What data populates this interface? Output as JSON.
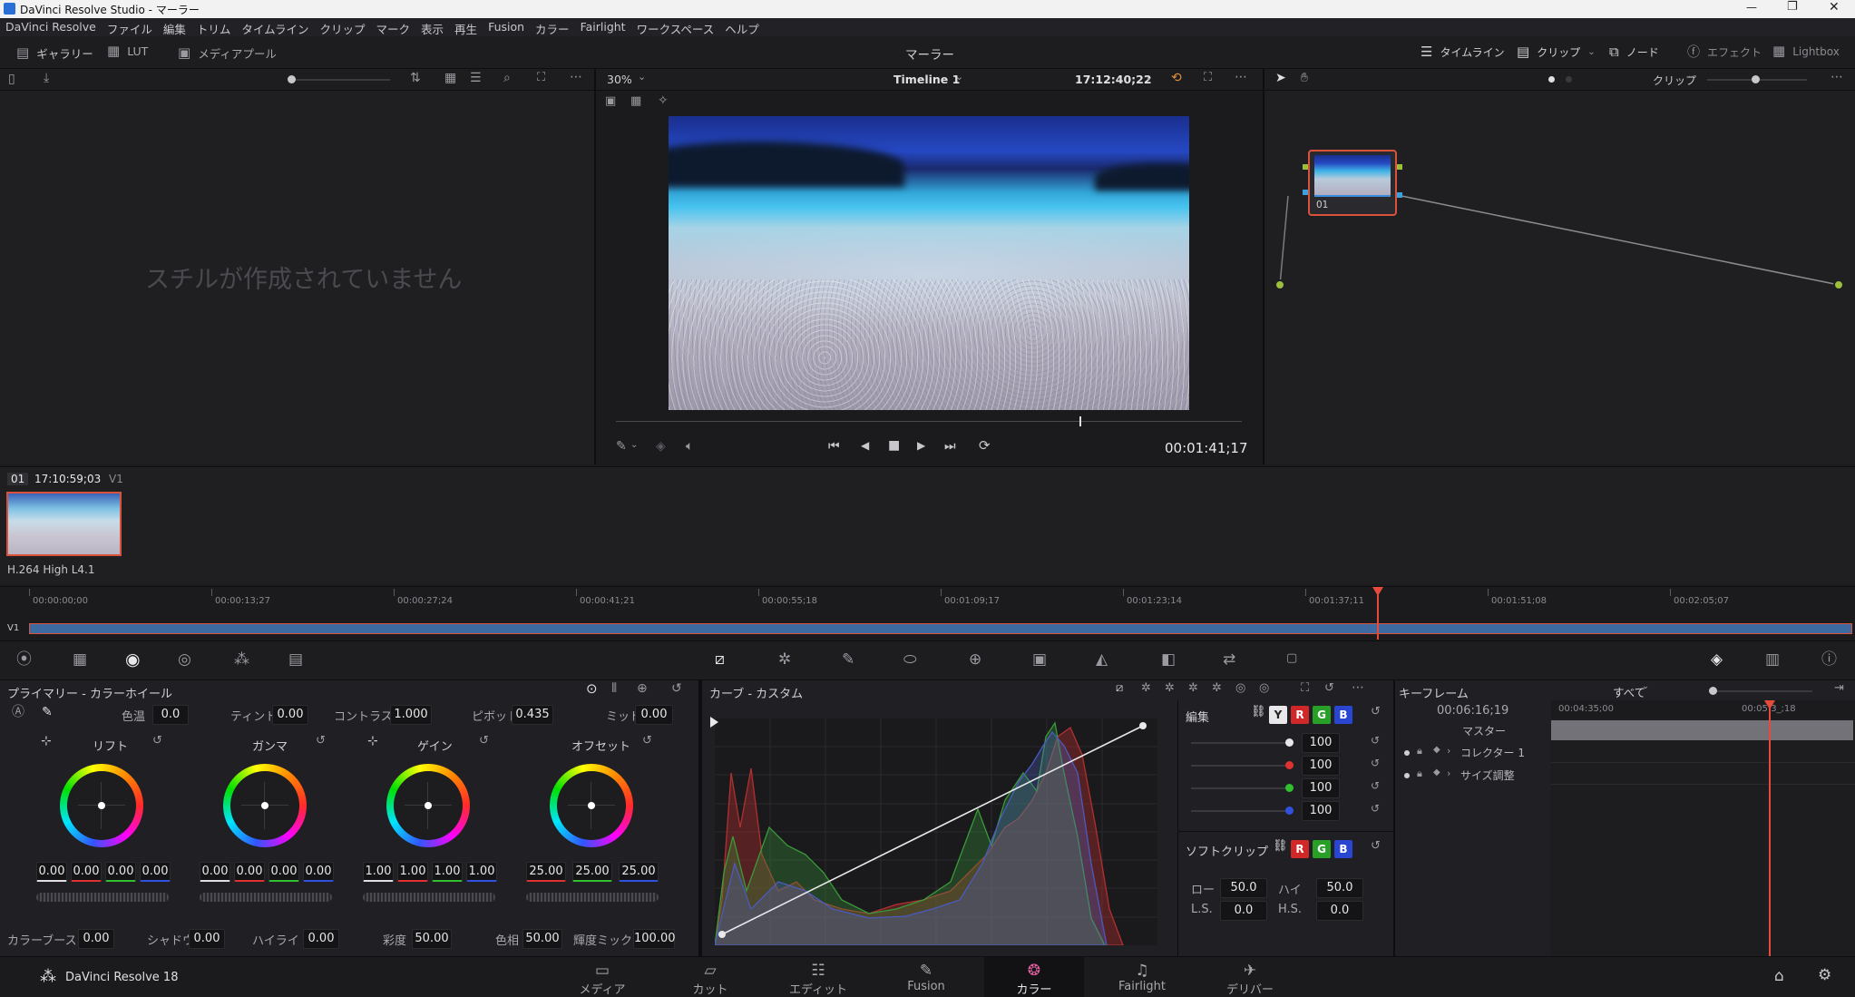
{
  "window": {
    "title": "DaVinci Resolve Studio - マーラー",
    "controls": [
      "—",
      "❐",
      "✕"
    ]
  },
  "menu": [
    "DaVinci Resolve",
    "ファイル",
    "編集",
    "トリム",
    "タイムライン",
    "クリップ",
    "マーク",
    "表示",
    "再生",
    "Fusion",
    "カラー",
    "Fairlight",
    "ワークスペース",
    "ヘルプ"
  ],
  "toolbar": {
    "left": [
      {
        "icon": "gallery-icon",
        "label": "ギャラリー"
      },
      {
        "icon": "lut-icon",
        "label": "LUT"
      },
      {
        "icon": "media-pool-icon",
        "label": "メディアプール"
      }
    ],
    "project_title": "マーラー",
    "right": [
      {
        "icon": "timeline-icon",
        "label": "タイムライン"
      },
      {
        "icon": "clips-icon",
        "label": "クリップ"
      },
      {
        "icon": "nodes-icon",
        "label": "ノード"
      },
      {
        "icon": "effects-icon",
        "label": "エフェクト"
      },
      {
        "icon": "lightbox-icon",
        "label": "Lightbox"
      }
    ]
  },
  "gallery": {
    "empty_message": "スチルが作成されていません"
  },
  "viewer": {
    "zoom": "30%",
    "timeline_name": "Timeline 1",
    "source_timecode": "17:12:40;22",
    "current_timecode": "00:01:41;17",
    "scrub_position": 0.74
  },
  "node_editor": {
    "mode": "クリップ",
    "node_label": "01"
  },
  "clip_strip": {
    "clip_number": "01",
    "clip_timecode": "17:10:59;03",
    "track": "V1",
    "codec": "H.264 High L4.1"
  },
  "timeline_ruler": {
    "ticks": [
      "00:00:00;00",
      "00:00:13;27",
      "00:00:27;24",
      "00:00:41;21",
      "00:00:55;18",
      "00:01:09;17",
      "00:01:23;14",
      "00:01:37;11",
      "00:01:51;08",
      "00:02:05;07"
    ],
    "track_label": "V1",
    "playhead_fraction": 0.74
  },
  "primaries": {
    "title": "プライマリー - カラーホイール",
    "color_temp_label": "色温",
    "color_temp": "0.0",
    "tint_label": "ティント",
    "tint": "0.00",
    "contrast_label": "コントラスト",
    "contrast": "1.000",
    "pivot_label": "ピボット",
    "pivot": "0.435",
    "middetail_label": "ミッド",
    "middetail": "0.00",
    "wheels": [
      {
        "name": "リフト",
        "values": [
          "0.00",
          "0.00",
          "0.00",
          "0.00"
        ]
      },
      {
        "name": "ガンマ",
        "values": [
          "0.00",
          "0.00",
          "0.00",
          "0.00"
        ]
      },
      {
        "name": "ゲイン",
        "values": [
          "1.00",
          "1.00",
          "1.00",
          "1.00"
        ]
      },
      {
        "name": "オフセット",
        "values": [
          "25.00",
          "25.00",
          "25.00"
        ]
      }
    ],
    "colorboost_label": "カラーブースト",
    "colorboost": "0.00",
    "shadow_label": "シャドウ",
    "shadow": "0.00",
    "highlight_label": "ハイライト",
    "highlight": "0.00",
    "saturation_label": "彩度",
    "saturation": "50.00",
    "hue_label": "色相",
    "hue": "50.00",
    "lummix_label": "輝度ミックス",
    "lummix": "100.00"
  },
  "curves": {
    "title": "カーブ - カスタム",
    "edit_label": "編集",
    "channels": [
      "Y",
      "R",
      "G",
      "B"
    ],
    "intensities": [
      "100",
      "100",
      "100",
      "100"
    ],
    "softclip_label": "ソフトクリップ",
    "low_label": "ロー",
    "low": "50.0",
    "high_label": "ハイ",
    "high": "50.0",
    "ls_label": "L.S.",
    "ls": "0.0",
    "hs_label": "H.S.",
    "hs": "0.0"
  },
  "keyframes": {
    "title": "キーフレーム",
    "filter": "すべて",
    "timecode": "00:06:16;19",
    "ruler": [
      "00:04:35;00",
      "00:05:3_;18"
    ],
    "rows": [
      "マスター",
      "コレクター 1",
      "サイズ調整"
    ]
  },
  "pages": {
    "app_name": "DaVinci Resolve 18",
    "items": [
      {
        "icon": "media-page-icon",
        "label": "メディア"
      },
      {
        "icon": "cut-page-icon",
        "label": "カット"
      },
      {
        "icon": "edit-page-icon",
        "label": "エディット"
      },
      {
        "icon": "fusion-page-icon",
        "label": "Fusion"
      },
      {
        "icon": "color-page-icon",
        "label": "カラー"
      },
      {
        "icon": "fairlight-page-icon",
        "label": "Fairlight"
      },
      {
        "icon": "deliver-page-icon",
        "label": "デリバー"
      }
    ],
    "active_index": 4
  },
  "colors": {
    "accent_red": "#e04040",
    "playhead": "#e64a3c",
    "selection_orange": "#d9533c"
  }
}
